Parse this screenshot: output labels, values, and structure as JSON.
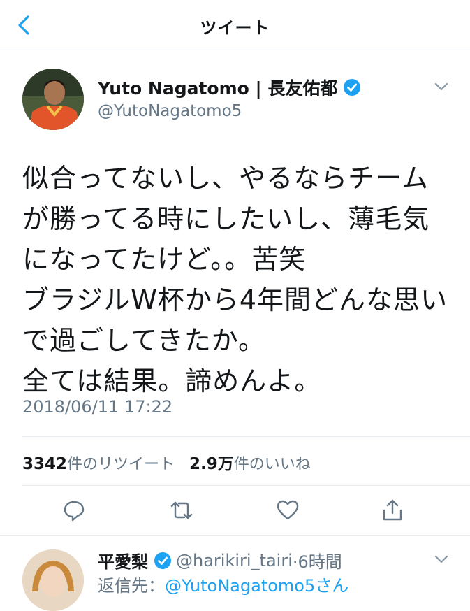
{
  "header": {
    "title": "ツイート"
  },
  "tweet": {
    "author_name": "Yuto Nagatomo | 長友佑都",
    "handle": "@YutoNagatomo5",
    "lines": [
      "似合ってないし、やるならチーム",
      "が勝ってる時にしたいし、薄毛気",
      "になってたけど。。苦笑",
      "ブラジルW杯から4年間どんな思い",
      "で過ごしてきたか。",
      "全ては結果。諦めんよ。"
    ],
    "timestamp": "2018/06/11 17:22",
    "retweet_count": "3342",
    "retweet_label": "件のリツイート",
    "like_count": "2.9万",
    "like_label": "件のいいね"
  },
  "reply": {
    "name": "平愛梨",
    "handle": "@harikiri_tairi",
    "time": "·6時間",
    "reply_to_label": "返信先：",
    "reply_to_handle": "@YutoNagatomo5さん"
  },
  "colors": {
    "accent": "#1da1f2",
    "secondary_text": "#657786",
    "divider": "#e6ecf0"
  },
  "icons": [
    "back-chevron-icon",
    "verified-badge-icon",
    "caret-down-icon",
    "reply-icon",
    "retweet-icon",
    "like-heart-icon",
    "share-icon"
  ]
}
